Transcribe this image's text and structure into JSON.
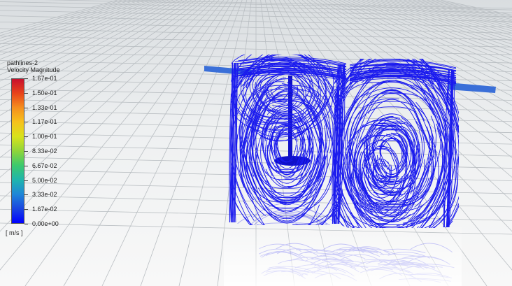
{
  "legend": {
    "title_line1": "pathlines-2",
    "title_line2": "Velocity Magnitude",
    "ticks": [
      "1.67e-01",
      "1.50e-01",
      "1.33e-01",
      "1.17e-01",
      "1.00e-01",
      "8.33e-02",
      "6.67e-02",
      "5.00e-02",
      "3.33e-02",
      "1.67e-02",
      "0.00e+00"
    ],
    "units": "[ m/s ]",
    "colormap": [
      "#c8102e",
      "#e8431a",
      "#f5901e",
      "#f6c21c",
      "#d8e21c",
      "#8fd53a",
      "#3cc96d",
      "#1fb5ad",
      "#1f86d8",
      "#1a45e0",
      "#0000ff"
    ]
  },
  "scene": {
    "pathline_color": "#1a1aee",
    "shaft_color": "#3a6fd8",
    "floor_grid_color": "#b9bec2"
  }
}
